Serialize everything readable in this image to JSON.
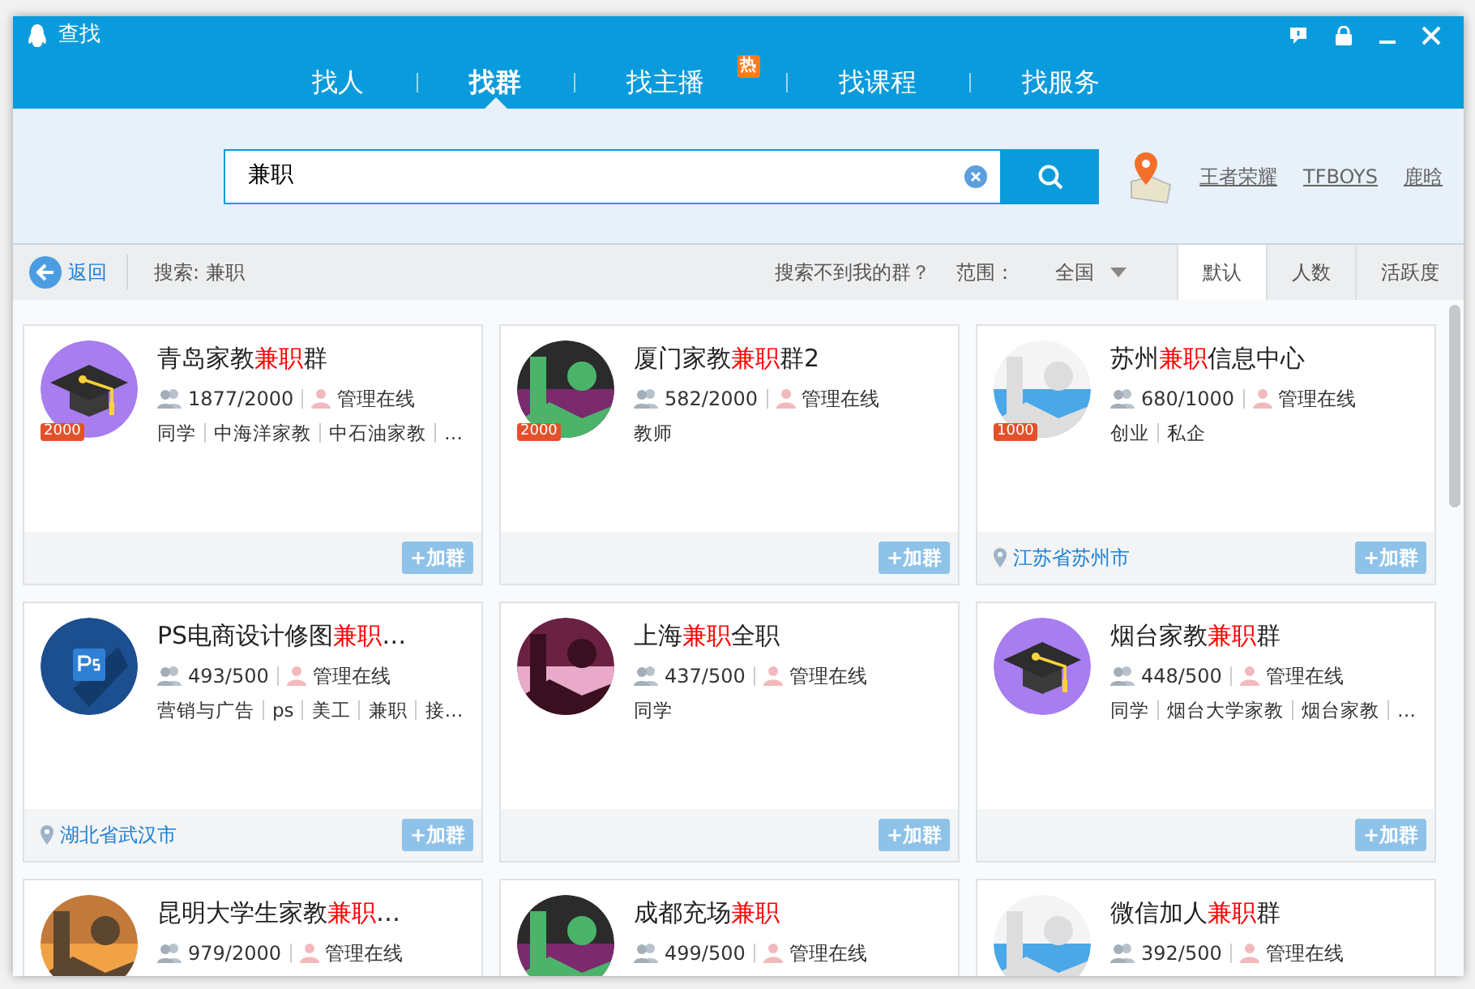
{
  "window": {
    "title": "查找"
  },
  "tabs": [
    {
      "label": "找人",
      "selected": false
    },
    {
      "label": "找群",
      "selected": true
    },
    {
      "label": "找主播",
      "selected": false,
      "badge": "热"
    },
    {
      "label": "找课程",
      "selected": false
    },
    {
      "label": "找服务",
      "selected": false
    }
  ],
  "search": {
    "value": "兼职"
  },
  "hot_links": [
    "王者荣耀",
    "TFBOYS",
    "鹿晗"
  ],
  "filter_bar": {
    "back": "返回",
    "query": "搜索: 兼职",
    "not_found": "搜索不到我的群？",
    "range_label": "范围：",
    "range_value": "全国"
  },
  "sort_tabs": [
    {
      "label": "默认",
      "selected": true
    },
    {
      "label": "人数",
      "selected": false
    },
    {
      "label": "活跃度",
      "selected": false
    }
  ],
  "groups": [
    {
      "name": [
        {
          "text": "青岛家教",
          "highlight": false
        },
        {
          "text": "兼职",
          "highlight": true
        },
        {
          "text": "群",
          "highlight": false
        }
      ],
      "avatar": {
        "kind": "cap",
        "badge": "2000"
      },
      "members": "1877/2000",
      "admin": "管理在线",
      "tags": [
        "同学",
        "中海洋家教",
        "中石油家教",
        "…"
      ],
      "join_button": "+加群"
    },
    {
      "name": [
        {
          "text": "厦门家教",
          "highlight": false
        },
        {
          "text": "兼职",
          "highlight": true
        },
        {
          "text": "群2",
          "highlight": false
        }
      ],
      "avatar": {
        "kind": "picture",
        "badge": "2000"
      },
      "members": "582/2000",
      "admin": "管理在线",
      "tags": [
        "教师"
      ],
      "join_button": "+加群"
    },
    {
      "name": [
        {
          "text": "苏州",
          "highlight": false
        },
        {
          "text": "兼职",
          "highlight": true
        },
        {
          "text": "信息中心",
          "highlight": false
        }
      ],
      "avatar": {
        "kind": "picture",
        "badge": "1000"
      },
      "members": "680/1000",
      "admin": "管理在线",
      "tags": [
        "创业",
        "私企"
      ],
      "location": "江苏省苏州市",
      "join_button": "+加群"
    },
    {
      "name": [
        {
          "text": "PS电商设计修图",
          "highlight": false
        },
        {
          "text": "兼职",
          "highlight": true
        },
        {
          "text": "…",
          "highlight": false
        }
      ],
      "avatar": {
        "kind": "ps"
      },
      "members": "493/500",
      "admin": "管理在线",
      "tags": [
        "营销与广告",
        "ps",
        "美工",
        "兼职",
        "接…"
      ],
      "location": "湖北省武汉市",
      "join_button": "+加群"
    },
    {
      "name": [
        {
          "text": "上海",
          "highlight": false
        },
        {
          "text": "兼职",
          "highlight": true
        },
        {
          "text": "全职",
          "highlight": false
        }
      ],
      "avatar": {
        "kind": "picture"
      },
      "members": "437/500",
      "admin": "管理在线",
      "tags": [
        "同学"
      ],
      "join_button": "+加群"
    },
    {
      "name": [
        {
          "text": "烟台家教",
          "highlight": false
        },
        {
          "text": "兼职",
          "highlight": true
        },
        {
          "text": "群",
          "highlight": false
        }
      ],
      "avatar": {
        "kind": "cap"
      },
      "members": "448/500",
      "admin": "管理在线",
      "tags": [
        "同学",
        "烟台大学家教",
        "烟台家教",
        "…"
      ],
      "join_button": "+加群"
    },
    {
      "name": [
        {
          "text": "昆明大学生家教",
          "highlight": false
        },
        {
          "text": "兼职",
          "highlight": true
        },
        {
          "text": "…",
          "highlight": false
        }
      ],
      "avatar": {
        "kind": "picture"
      },
      "members": "979/2000",
      "admin": "管理在线"
    },
    {
      "name": [
        {
          "text": "成都充场",
          "highlight": false
        },
        {
          "text": "兼职",
          "highlight": true
        }
      ],
      "avatar": {
        "kind": "picture"
      },
      "members": "499/500",
      "admin": "管理在线"
    },
    {
      "name": [
        {
          "text": "微信加人",
          "highlight": false
        },
        {
          "text": "兼职",
          "highlight": true
        },
        {
          "text": "群",
          "highlight": false
        }
      ],
      "avatar": {
        "kind": "picture"
      },
      "members": "392/500",
      "admin": "管理在线"
    }
  ]
}
